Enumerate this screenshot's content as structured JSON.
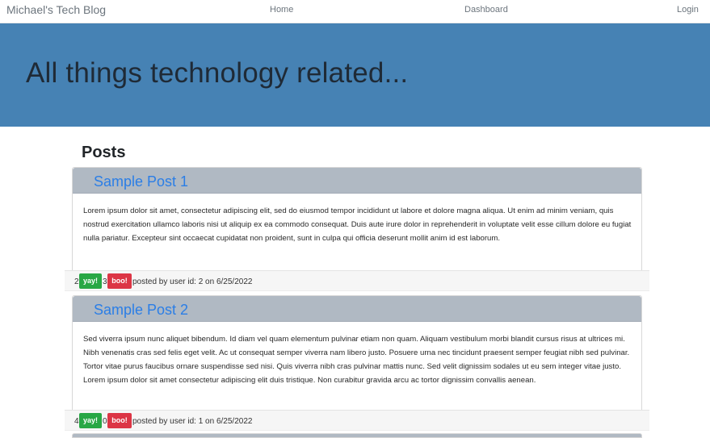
{
  "navbar": {
    "brand": "Michael's Tech Blog",
    "links": [
      "Home",
      "Dashboard",
      "Login"
    ]
  },
  "hero": {
    "title": "All things technology related..."
  },
  "posts_heading": "Posts",
  "posts": [
    {
      "title": "Sample Post 1",
      "body": "Lorem ipsum dolor sit amet, consectetur adipiscing elit, sed do eiusmod tempor incididunt ut labore et dolore magna aliqua. Ut enim ad minim veniam, quis nostrud exercitation ullamco laboris nisi ut aliquip ex ea commodo consequat. Duis aute irure dolor in reprehenderit in voluptate velit esse cillum dolore eu fugiat nulla pariatur. Excepteur sint occaecat cupidatat non proident, sunt in culpa qui officia deserunt mollit anim id est laborum.",
      "yay_count": "2",
      "boo_count": "3",
      "yay_label": "yay!",
      "boo_label": "boo!",
      "posted_by": "posted by user id: 2 on 6/25/2022"
    },
    {
      "title": "Sample Post 2",
      "body": "Sed viverra ipsum nunc aliquet bibendum. Id diam vel quam elementum pulvinar etiam non quam. Aliquam vestibulum morbi blandit cursus risus at ultrices mi. Nibh venenatis cras sed felis eget velit. Ac ut consequat semper viverra nam libero justo. Posuere urna nec tincidunt praesent semper feugiat nibh sed pulvinar. Tortor vitae purus faucibus ornare suspendisse sed nisi. Quis viverra nibh cras pulvinar mattis nunc. Sed velit dignissim sodales ut eu sem integer vitae justo. Lorem ipsum dolor sit amet consectetur adipiscing elit duis tristique. Non curabitur gravida arcu ac tortor dignissim convallis aenean.",
      "yay_count": "4",
      "boo_count": "0",
      "yay_label": "yay!",
      "boo_label": "boo!",
      "posted_by": "posted by user id: 1 on 6/25/2022"
    }
  ],
  "colors": {
    "hero_bg": "#4682b4",
    "card_header_bg": "#b0b9c3",
    "title_link": "#2b7ee6",
    "yay_button": "#28a745",
    "boo_button": "#dc3545"
  }
}
